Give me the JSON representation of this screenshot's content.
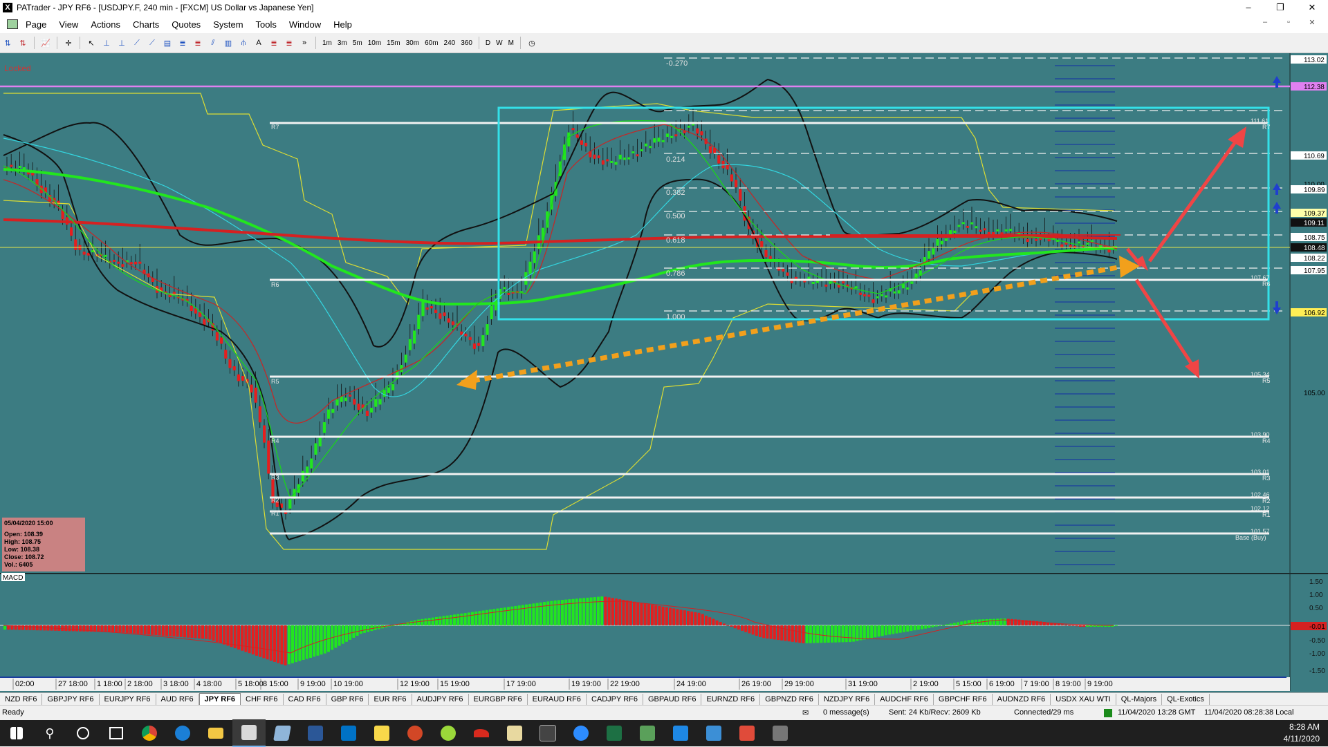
{
  "window": {
    "title": "PATrader - JPY RF6 - [USDJPY.F, 240 min - [FXCM] US Dollar vs Japanese Yen]",
    "minimize": "–",
    "restore": "❐",
    "close": "✕"
  },
  "menu": {
    "items": [
      "Page",
      "View",
      "Actions",
      "Charts",
      "Quotes",
      "System",
      "Tools",
      "Window",
      "Help"
    ],
    "mdi": [
      "–",
      "▫",
      "✕"
    ]
  },
  "toolbar": {
    "timeframes": [
      "1m",
      "3m",
      "5m",
      "10m",
      "15m",
      "30m",
      "60m",
      "240",
      "360"
    ],
    "periods": [
      "D",
      "W",
      "M"
    ]
  },
  "chart": {
    "locked_label": "Locked",
    "price_axis": [
      "113.02",
      "112.38",
      "111.61",
      "110.69",
      "110.00",
      "109.89",
      "109.37",
      "109.11",
      "108.75",
      "108.48",
      "108.22",
      "107.95",
      "106.92",
      "105.00"
    ],
    "fib_labels": [
      "-0.270",
      "0.214",
      "0.382",
      "0.500",
      "0.618",
      "0.786",
      "1.000"
    ],
    "sr_levels": [
      {
        "name": "R7",
        "value": "111.61"
      },
      {
        "name": "R6",
        "value": "107.67"
      },
      {
        "name": "R5",
        "value": "105.34"
      },
      {
        "name": "R4",
        "value": "103.90"
      },
      {
        "name": "R3",
        "value": "103.01"
      },
      {
        "name": "R2",
        "value": "102.46"
      },
      {
        "name": "R1",
        "value": "102.12"
      },
      {
        "name": "Base (Buy)",
        "value": "101.57"
      }
    ],
    "ohlc_box": {
      "date": "05/04/2020 15:00",
      "open": "Open: 108.39",
      "high": "High: 108.75",
      "low": "Low: 108.38",
      "close": "Close: 108.72",
      "vol": "Vol.: 6405"
    },
    "macd": {
      "label": "MACD",
      "axis": [
        "1.50",
        "1.00",
        "0.50",
        "0.00",
        "-0.50",
        "-1.00",
        "-1.50"
      ],
      "current": "-0.01"
    },
    "time_axis": [
      "02:00",
      "27 18:00",
      "1 18:00",
      "2 18:00",
      "3 18:00",
      "4 18:00",
      "5 18:00",
      "8 15:00",
      "9 19:00",
      "10 19:00",
      "12 19:00",
      "15 19:00",
      "17 19:00",
      "19 19:00",
      "22 19:00",
      "24 19:00",
      "26 19:00",
      "29 19:00",
      "31 19:00",
      "2 19:00",
      "5 15:00",
      "6 19:00",
      "7 19:00",
      "8 19:00",
      "9 19:00"
    ],
    "colors": {
      "background": "#3c7c82",
      "bull": "#22e61e",
      "bear": "#e61e1e",
      "box": "#33e0e8",
      "arrow_red": "#f04545",
      "arrow_orange": "#f2a01c"
    }
  },
  "symbol_tabs": {
    "items": [
      "NZD RF6",
      "GBPJPY RF6",
      "EURJPY RF6",
      "AUD RF6",
      "JPY RF6",
      "CHF RF6",
      "CAD RF6",
      "GBP RF6",
      "EUR RF6",
      "AUDJPY RF6",
      "EURGBP RF6",
      "EURAUD RF6",
      "CADJPY RF6",
      "GBPAUD RF6",
      "EURNZD RF6",
      "GBPNZD RF6",
      "NZDJPY RF6",
      "AUDCHF RF6",
      "GBPCHF RF6",
      "AUDNZD RF6",
      "USDX XAU WTI",
      "QL-Majors",
      "QL-Exotics"
    ],
    "active": "JPY RF6"
  },
  "status": {
    "ready": "Ready",
    "messages": "0 message(s)",
    "traffic": "Sent: 24 Kb/Recv: 2609 Kb",
    "connected": "Connected/29 ms",
    "gmt": "11/04/2020 13:28 GMT",
    "local": "11/04/2020 08:28:38 Local"
  },
  "taskbar": {
    "time": "8:28 AM",
    "date": "4/11/2020"
  }
}
